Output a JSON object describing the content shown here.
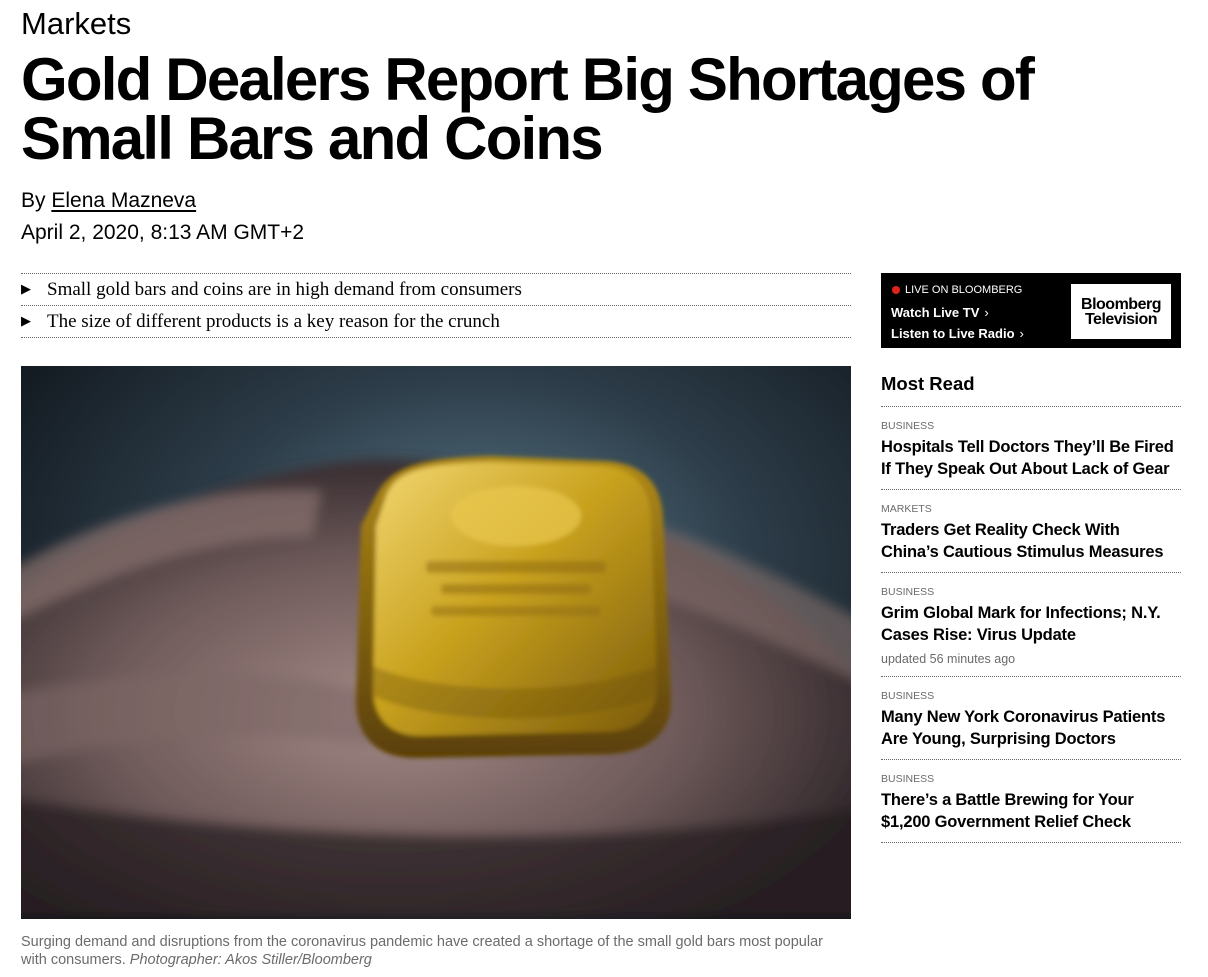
{
  "article": {
    "kicker": "Markets",
    "headline": "Gold Dealers Report Big Shortages of Small Bars and Coins",
    "by_prefix": "By",
    "author": "Elena Mazneva",
    "date": "April 2, 2020, 8:13 AM GMT+2",
    "bullets": [
      "Small gold bars and coins are in high demand from consumers",
      "The size of different products is a key reason for the crunch"
    ],
    "caption": "Surging demand and disruptions from the coronavirus pandemic have created a shortage of the small gold bars most popular with consumers.",
    "photo_credit": "Photographer: Akos Stiller/Bloomberg"
  },
  "live": {
    "tag": "LIVE ON BLOOMBERG",
    "watch": "Watch Live TV",
    "listen": "Listen to Live Radio",
    "logo_line1": "Bloomberg",
    "logo_line2": "Television"
  },
  "most_read": {
    "title": "Most Read",
    "items": [
      {
        "section": "BUSINESS",
        "title": "Hospitals Tell Doctors They’ll Be Fired If They Speak Out About Lack of Gear"
      },
      {
        "section": "MARKETS",
        "title": "Traders Get Reality Check With China’s Cautious Stimulus Measures"
      },
      {
        "section": "BUSINESS",
        "title": "Grim Global Mark for Infections; N.Y. Cases Rise: Virus Update",
        "updated": "updated 56 minutes ago"
      },
      {
        "section": "BUSINESS",
        "title": "Many New York Coronavirus Patients Are Young, Surprising Doctors"
      },
      {
        "section": "BUSINESS",
        "title": "There’s a Battle Brewing for Your $1,200 Government Relief Check"
      }
    ]
  },
  "colors": {
    "live_dot": "#e0241b",
    "caption_gray": "#6b6b6b",
    "gold": "#c9a21e"
  }
}
